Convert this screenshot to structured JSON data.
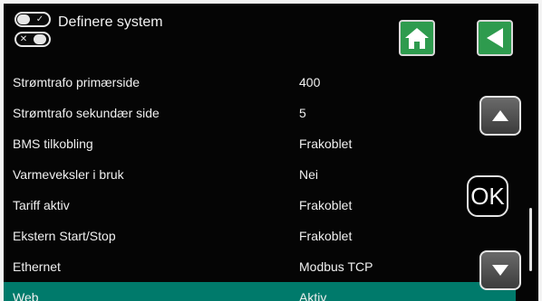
{
  "header": {
    "title": "Definere system",
    "home_icon": "home-icon",
    "back_icon": "back-arrow-icon",
    "accent": "#2e9b4e"
  },
  "rows": [
    {
      "label": "Strømtrafo primærside",
      "value": "400"
    },
    {
      "label": "Strømtrafo sekundær side",
      "value": "5"
    },
    {
      "label": "BMS tilkobling",
      "value": "Frakoblet"
    },
    {
      "label": "Varmeveksler i bruk",
      "value": "Nei"
    },
    {
      "label": "Tariff aktiv",
      "value": "Frakoblet"
    },
    {
      "label": "Ekstern Start/Stop",
      "value": "Frakoblet"
    },
    {
      "label": "Ethernet",
      "value": "Modbus TCP"
    },
    {
      "label": "Web",
      "value": "Aktiv",
      "selected": true
    }
  ],
  "controls": {
    "ok_label": "OK",
    "up_icon": "arrow-up-icon",
    "down_icon": "arrow-down-icon"
  },
  "selection_color": "#007a6b"
}
